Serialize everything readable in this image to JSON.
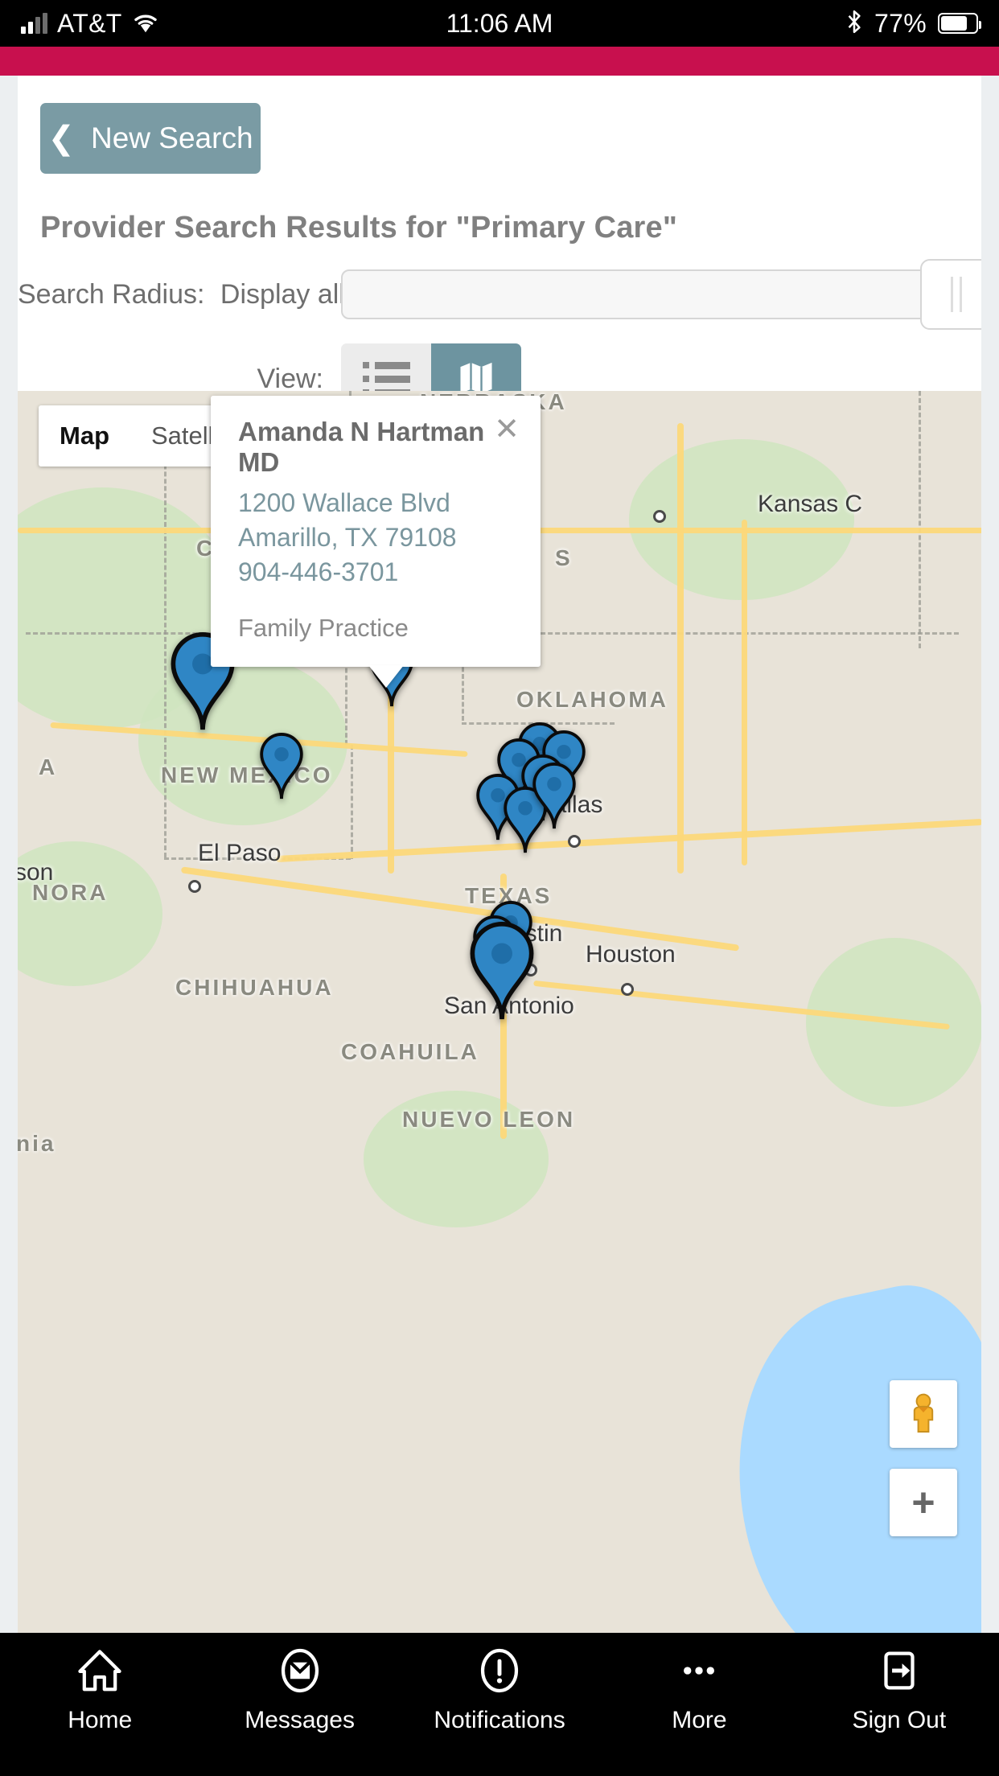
{
  "status_bar": {
    "carrier": "AT&T",
    "time": "11:06 AM",
    "battery_percent": "77%",
    "signal_icon": "cellular-signal-icon",
    "wifi_icon": "wifi-icon",
    "bluetooth_icon": "bluetooth-icon",
    "battery_icon": "battery-icon"
  },
  "brand": {
    "color": "#c8104e"
  },
  "header": {
    "new_search_label": "New Search",
    "back_chevron_icon": "chevron-left-icon",
    "results_title": "Provider Search Results for \"Primary Care\"",
    "radius_label": "Search Radius:",
    "radius_value": "Display all",
    "view_label": "View:",
    "list_view_icon": "list-icon",
    "map_view_icon": "map-icon",
    "active_view": "map"
  },
  "map": {
    "map_type_tabs": [
      {
        "label": "Map",
        "active": true
      },
      {
        "label": "Satellite",
        "active": false
      }
    ],
    "region_labels": [
      "NEBRASKA",
      "COL",
      "OKLAHOMA",
      "NEW MEXICO",
      "TEXAS",
      "CHIHUAHUA",
      "COAHUILA",
      "NUEVO LEON",
      "NORA",
      "A",
      "S",
      "nia"
    ],
    "city_labels": [
      "Kansas C",
      "Dallas",
      "El Paso",
      "son",
      "ustin",
      "Houston",
      "San Antonio"
    ],
    "pegman_icon": "pegman-street-view-icon",
    "zoom_in_label": "+",
    "zoom_in_icon": "plus-icon",
    "marker_icon": "map-pin-icon",
    "marker_count": 14
  },
  "info_window": {
    "provider_name": "Amanda N Hartman MD",
    "address_line1": "1200 Wallace Blvd",
    "address_line2": "Amarillo, TX 79108",
    "phone": "904-446-3701",
    "specialty": "Family Practice",
    "close_icon": "close-icon",
    "close_label": "✕"
  },
  "bottom_nav": [
    {
      "label": "Home",
      "icon": "home-icon"
    },
    {
      "label": "Messages",
      "icon": "envelope-icon"
    },
    {
      "label": "Notifications",
      "icon": "alert-circle-icon"
    },
    {
      "label": "More",
      "icon": "ellipsis-icon"
    },
    {
      "label": "Sign Out",
      "icon": "sign-out-icon"
    }
  ],
  "colors": {
    "brand": "#c8104e",
    "accent_teal": "#7a9ba4",
    "marker_blue": "#2f86c5"
  }
}
